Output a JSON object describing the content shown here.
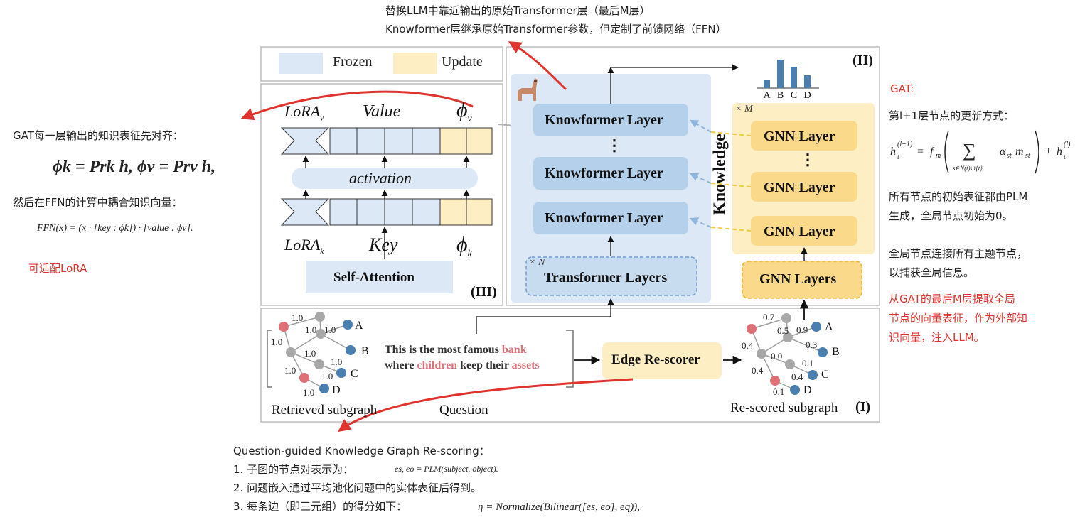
{
  "top_note": {
    "line1": "替换LLM中靠近输出的原始Transformer层（最后M层）",
    "line2": "Knowformer层继承原始Transformer参数，但定制了前馈网络（FFN）"
  },
  "left_notes": {
    "gat_align": "GAT每一层输出的知识表征先对齐：",
    "formula_proj": "ϕk = Prk h, ϕv = Prv h,",
    "ffn_couple": "然后在FFN的计算中耦合知识向量：",
    "ffn_formula": "FFN(x) = (x · [key : ϕk]) · [value : ϕv].",
    "lora_compat": "可适配LoRA"
  },
  "right_notes": {
    "gat_title": "GAT:",
    "update_rule": "第l+1层节点的更新方式：",
    "update_formula_lhs": "h",
    "init_repr_1": "所有节点的初始表征都由PLM",
    "init_repr_2": "生成，全局节点初始为0。",
    "global_node_1": "全局节点连接所有主题节点，",
    "global_node_2": "以捕获全局信息。",
    "extract_1": "从GAT的最后M层提取全局",
    "extract_2": "节点的向量表征，作为外部知",
    "extract_3": "识向量，注入LLM。"
  },
  "bottom_notes": {
    "title": "Question-guided Knowledge Graph Re-scoring：",
    "item1": "1. 子图的节点对表示为：",
    "item1_formula": "es, eo = PLM(subject, object).",
    "item2": "2. 问题嵌入通过平均池化问题中的实体表征后得到。",
    "item3": "3. 每条边（即三元组）的得分如下：",
    "item3_formula": "η = Normalize(Bilinear([es, eo], eq)),"
  },
  "legend": {
    "frozen": "Frozen",
    "update": "Update"
  },
  "panel3": {
    "lora_v": "LoRA",
    "lora_v_sub": "v",
    "value": "Value",
    "phi_v": "ϕ",
    "phi_v_sub": "v",
    "activation": "activation",
    "lora_k": "LoRA",
    "lora_k_sub": "k",
    "key": "Key",
    "phi_k": "ϕ",
    "phi_k_sub": "k",
    "self_attention": "Self-Attention",
    "label": "(III)"
  },
  "panel2": {
    "label": "(II)",
    "knowformer_layer": "Knowformer  Layer",
    "transformer_layers": "Transformer Layers",
    "times_n": "× N",
    "times_m": "× M",
    "knowledge": "Knowledge",
    "gnn_layer": "GNN  Layer",
    "gnn_layers": "GNN  Layers",
    "dots": "⋮"
  },
  "chart_data": {
    "type": "bar",
    "categories": [
      "A",
      "B",
      "C",
      "D"
    ],
    "values": [
      0.3,
      1.0,
      0.75,
      0.45
    ],
    "title": "",
    "xlabel": "",
    "ylabel": ""
  },
  "panel1": {
    "label": "(I)",
    "retrieved_subgraph": "Retrieved subgraph",
    "question_label": "Question",
    "question_parts": [
      "This is the most famous ",
      "bank",
      "where ",
      "children",
      " keep their ",
      "assets"
    ],
    "edge_rescorer": "Edge Re-scorer",
    "rescored_subgraph": "Re-scored subgraph",
    "left_edge_weights": [
      "1.0",
      "1.0",
      "1.0",
      "1.0",
      "1.0",
      "1.0",
      "1.0",
      "1.0",
      "1.0",
      "1.0"
    ],
    "right_edge_weights": [
      "0.7",
      "0.5",
      "0.9",
      "0.4",
      "0.3",
      "0.0",
      "0.4",
      "0.1",
      "0.4",
      "0.1"
    ],
    "node_labels": [
      "A",
      "B",
      "C",
      "D"
    ]
  },
  "colors": {
    "frozen": "#dce8f5",
    "update": "#fdeec4",
    "red_annot": "#e0332e",
    "node_blue": "#4a7fb0",
    "node_red": "#e07078",
    "node_gray": "#a8a8a8"
  }
}
